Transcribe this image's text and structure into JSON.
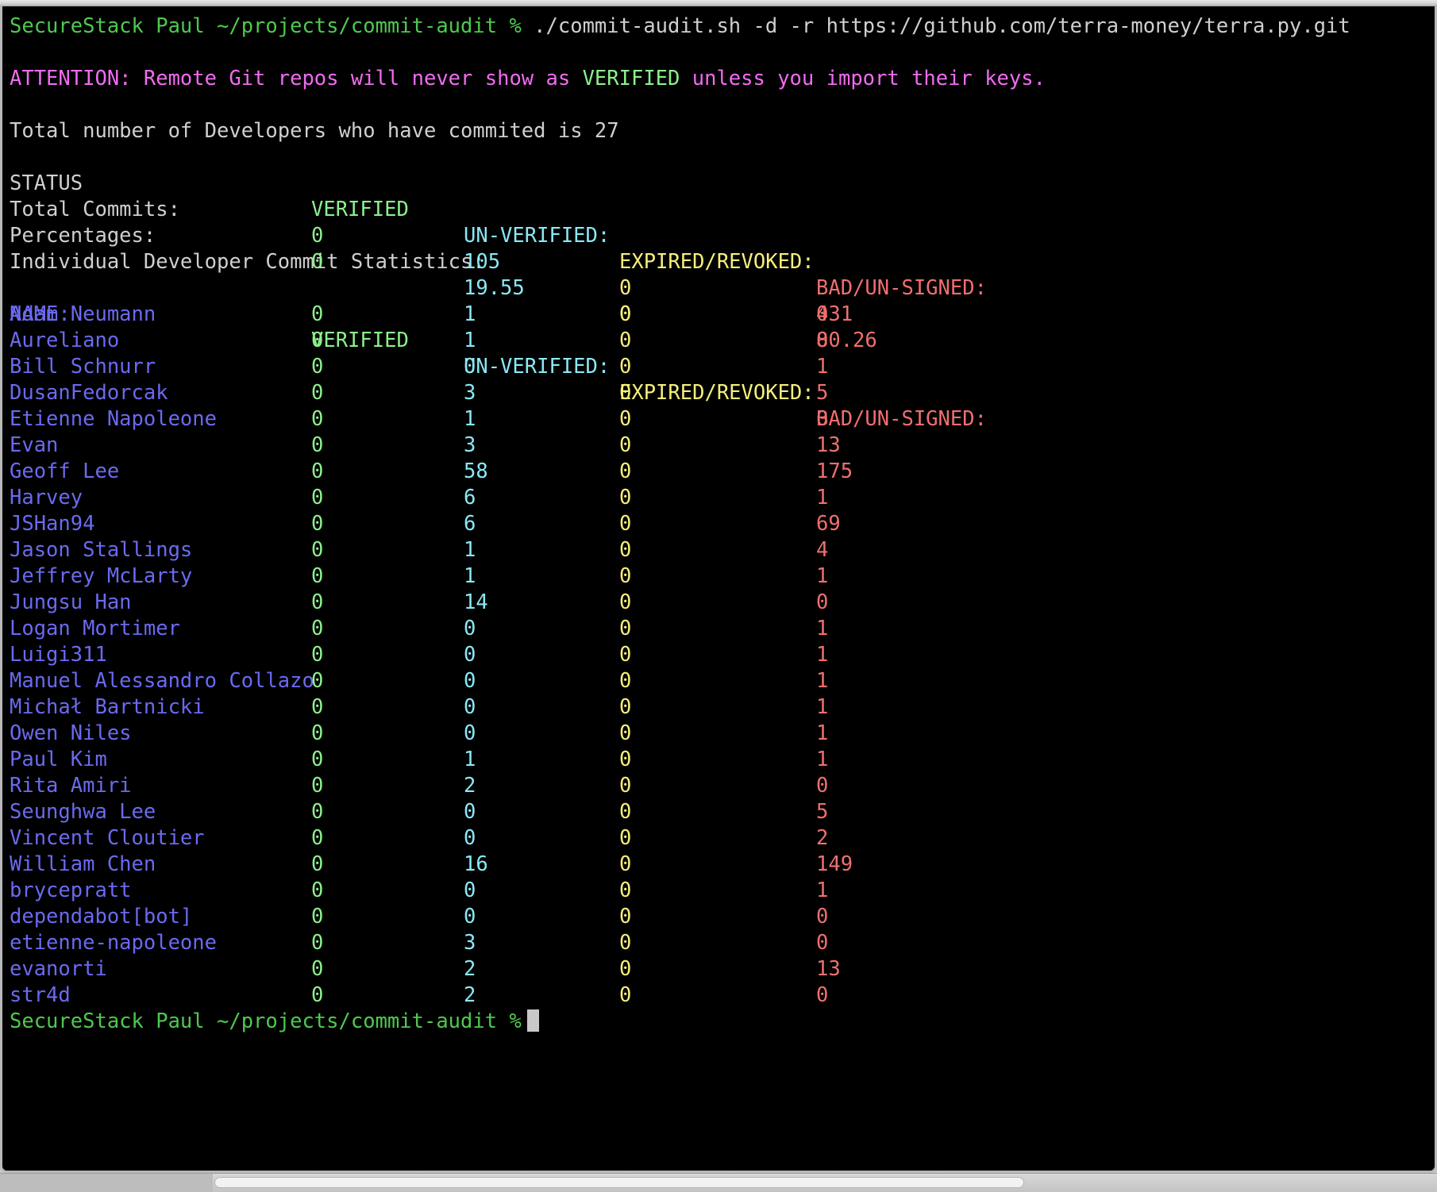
{
  "terminal": {
    "prompt": "SecureStack Paul ~/projects/commit-audit %",
    "command": "./commit-audit.sh -d -r https://github.com/terra-money/terra.py.git",
    "attention": "ATTENTION: Remote Git repos will never show as VERIFIED unless you import their keys.",
    "attention_highlight": "VERIFIED",
    "attention_prefix": "ATTENTION: Remote Git repos will never show as ",
    "attention_suffix": " unless you import their keys.",
    "total_developers_line": "Total number of Developers who have commited is 27",
    "individual_header": "Individual Developer Commit Statistics:",
    "final_prompt": "SecureStack Paul ~/projects/commit-audit %"
  },
  "colors": {
    "background": "#000000",
    "prompt_green": "#4ec94e",
    "white": "#cfcfcf",
    "magenta": "#f06cf0",
    "verified_green": "#8cf08c",
    "unverified_cyan": "#8ae8f5",
    "expired_yellow": "#f5ef7a",
    "bad_red": "#ef6f6f",
    "name_blue": "#6a6af0",
    "cursor": "#c8c8c8"
  },
  "summary": {
    "status_label": "STATUS",
    "headers": {
      "verified": "VERIFIED",
      "unverified": "UN-VERIFIED:",
      "expired": "EXPIRED/REVOKED:",
      "bad": "BAD/UN-SIGNED:"
    },
    "rows": [
      {
        "label": "Total Commits:",
        "verified": "0",
        "unverified": "105",
        "expired": "0",
        "bad": "431"
      },
      {
        "label": "Percentages:",
        "verified": "0",
        "unverified": "19.55",
        "expired": "0",
        "bad": "80.26"
      }
    ]
  },
  "developers": {
    "name_header": "NAME:",
    "headers": {
      "verified": "VERIFIED",
      "unverified": "UN-VERIFIED:",
      "expired": "EXPIRED/REVOKED:",
      "bad": "BAD/UN-SIGNED:"
    },
    "rows": [
      {
        "name": "Adam Neumann",
        "verified": "0",
        "unverified": "1",
        "expired": "0",
        "bad": "0"
      },
      {
        "name": "Aureliano",
        "verified": "0",
        "unverified": "1",
        "expired": "0",
        "bad": "0"
      },
      {
        "name": "Bill Schnurr",
        "verified": "0",
        "unverified": "0",
        "expired": "0",
        "bad": "1"
      },
      {
        "name": "DusanFedorcak",
        "verified": "0",
        "unverified": "3",
        "expired": "0",
        "bad": "5"
      },
      {
        "name": "Etienne Napoleone",
        "verified": "0",
        "unverified": "1",
        "expired": "0",
        "bad": "0"
      },
      {
        "name": "Evan",
        "verified": "0",
        "unverified": "3",
        "expired": "0",
        "bad": "13"
      },
      {
        "name": "Geoff Lee",
        "verified": "0",
        "unverified": "58",
        "expired": "0",
        "bad": "175"
      },
      {
        "name": "Harvey",
        "verified": "0",
        "unverified": "6",
        "expired": "0",
        "bad": "1"
      },
      {
        "name": "JSHan94",
        "verified": "0",
        "unverified": "6",
        "expired": "0",
        "bad": "69"
      },
      {
        "name": "Jason Stallings",
        "verified": "0",
        "unverified": "1",
        "expired": "0",
        "bad": "4"
      },
      {
        "name": "Jeffrey McLarty",
        "verified": "0",
        "unverified": "1",
        "expired": "0",
        "bad": "1"
      },
      {
        "name": "Jungsu Han",
        "verified": "0",
        "unverified": "14",
        "expired": "0",
        "bad": "0"
      },
      {
        "name": "Logan Mortimer",
        "verified": "0",
        "unverified": "0",
        "expired": "0",
        "bad": "1"
      },
      {
        "name": "Luigi311",
        "verified": "0",
        "unverified": "0",
        "expired": "0",
        "bad": "1"
      },
      {
        "name": "Manuel Alessandro Collazo",
        "verified": "0",
        "unverified": "0",
        "expired": "0",
        "bad": "1"
      },
      {
        "name": "Michał Bartnicki",
        "verified": "0",
        "unverified": "0",
        "expired": "0",
        "bad": "1"
      },
      {
        "name": "Owen Niles",
        "verified": "0",
        "unverified": "0",
        "expired": "0",
        "bad": "1"
      },
      {
        "name": "Paul Kim",
        "verified": "0",
        "unverified": "1",
        "expired": "0",
        "bad": "1"
      },
      {
        "name": "Rita Amiri",
        "verified": "0",
        "unverified": "2",
        "expired": "0",
        "bad": "0"
      },
      {
        "name": "Seunghwa Lee",
        "verified": "0",
        "unverified": "0",
        "expired": "0",
        "bad": "5"
      },
      {
        "name": "Vincent Cloutier",
        "verified": "0",
        "unverified": "0",
        "expired": "0",
        "bad": "2"
      },
      {
        "name": "William Chen",
        "verified": "0",
        "unverified": "16",
        "expired": "0",
        "bad": "149"
      },
      {
        "name": "brycepratt",
        "verified": "0",
        "unverified": "0",
        "expired": "0",
        "bad": "1"
      },
      {
        "name": "dependabot[bot]",
        "verified": "0",
        "unverified": "0",
        "expired": "0",
        "bad": "0"
      },
      {
        "name": "etienne-napoleone",
        "verified": "0",
        "unverified": "3",
        "expired": "0",
        "bad": "0"
      },
      {
        "name": "evanorti",
        "verified": "0",
        "unverified": "2",
        "expired": "0",
        "bad": "13"
      },
      {
        "name": "str4d",
        "verified": "0",
        "unverified": "2",
        "expired": "0",
        "bad": "0"
      }
    ]
  }
}
